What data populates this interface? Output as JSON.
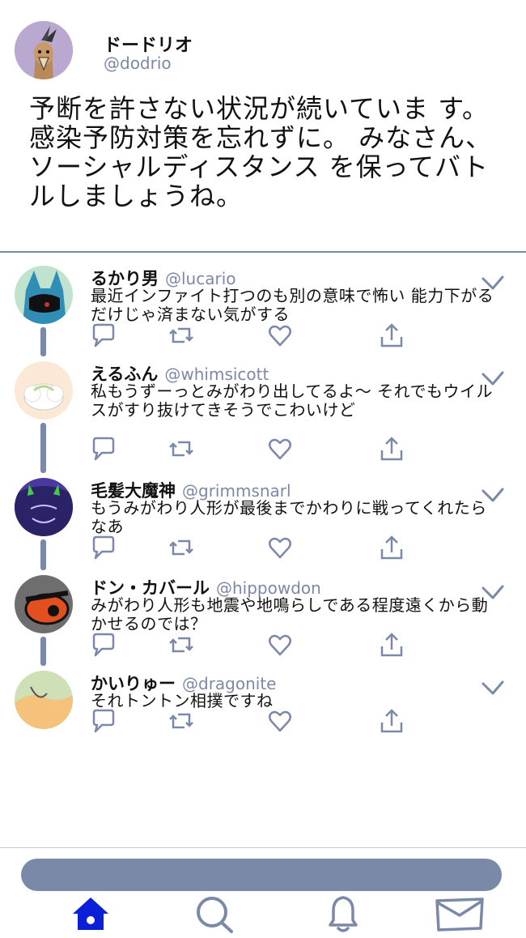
{
  "main_post": {
    "name": "ドードリオ",
    "handle": "@dodrio",
    "text": "予断を許さない状況が続いていま す。 感染予防対策を忘れずに。 みなさん、ソーシャルディスタンス を保ってバトルしましょうね。"
  },
  "replies": [
    {
      "name": "るかり男",
      "handle": "@lucario",
      "text": "最近インファイト打つのも別の意味で怖い 能力下がるだけじゃ済まない気がする"
    },
    {
      "name": "えるふん",
      "handle": "@whimsicott",
      "text": "私もうずーっとみがわり出してるよ～ それでもウイルスがすり抜けてきそうでこわいけど"
    },
    {
      "name": "毛髪大魔神",
      "handle": "@grimmsnarl",
      "text": "もうみがわり人形が最後までかわりに戦ってくれたらなあ"
    },
    {
      "name": "ドン・カバール",
      "handle": "@hippowdon",
      "text": "みがわり人形も地震や地鳴らしである程度遠くから動かせるのでは？"
    },
    {
      "name": "かいりゅー",
      "handle": "@dragonite",
      "text": "それトントン相撲ですね"
    }
  ],
  "icons": {
    "reply": "speech-bubble-icon",
    "retweet": "retweet-icon",
    "like": "heart-icon",
    "share": "share-icon",
    "check": "checkmark-icon",
    "nav": [
      "home-icon",
      "search-icon",
      "bell-icon",
      "mail-icon"
    ]
  },
  "colors": {
    "accent": "#0a1fd6",
    "ui_gray_blue": "#7b89a8",
    "handle": "#7c89a6"
  }
}
